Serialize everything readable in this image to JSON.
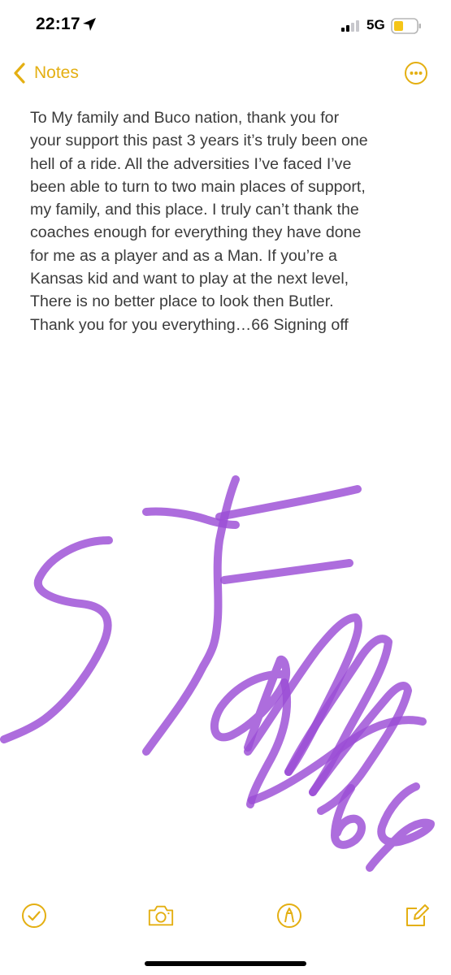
{
  "status_bar": {
    "time": "22:17",
    "network": "5G",
    "battery_color": "#f5c518"
  },
  "nav": {
    "back_label": "Notes",
    "accent_color": "#e4af12"
  },
  "note": {
    "body": "To My family and Buco nation, thank you for\nyour support this past 3 years it’s truly been one\nhell of a ride. All the adversities I’ve faced I’ve\nbeen able to turn to two main places of support,\nmy family, and this place. I truly can’t thank the\ncoaches enough for everything they have done\nfor me as a player and as a Man. If you’re a\nKansas kid and want to play at the next level,\nThere is no better place to look then Butler.\nThank you for you everything…66 Signing off"
  },
  "drawing": {
    "description_icon": "handwritten-signature",
    "ink_color": "#9b4dd6"
  },
  "toolbar": {
    "items": [
      "checklist-icon",
      "camera-icon",
      "markup-icon",
      "compose-icon"
    ]
  }
}
